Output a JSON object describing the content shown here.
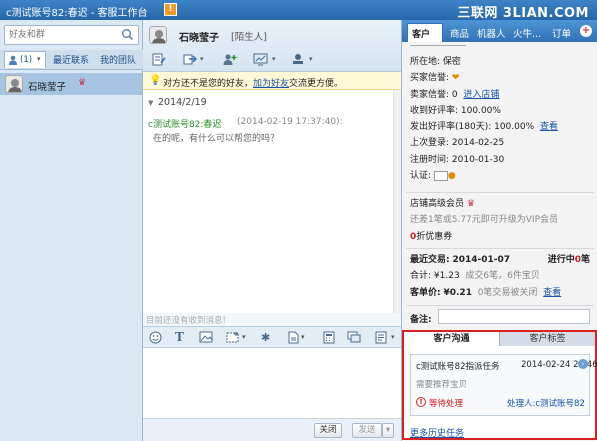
{
  "window": {
    "title": "c测试账号82:春迟 - 客服工作台",
    "watermark": "三联网 3LIAN.COM"
  },
  "left": {
    "search_placeholder": "好友和群",
    "tabs": {
      "contacts_count": "(1)",
      "recent": "最近联系",
      "team": "我的团队"
    },
    "contact": {
      "name": "石晓莹子"
    }
  },
  "chat": {
    "header": {
      "name": "石晓莹子",
      "tag": "[陌生人]"
    },
    "notice": {
      "before": "对方还不是您的好友，",
      "link": "加为好友",
      "after": "交流更方便。"
    },
    "date": "2014/2/19",
    "message": {
      "sender": "c测试账号82:春迟",
      "time": "(2014-02-19 17:37:40):",
      "text": "在的呢，有什么可以帮您的吗？"
    },
    "footer_hint": "目前还没有收到消息!",
    "buttons": {
      "close": "关闭",
      "send": "发送"
    }
  },
  "right": {
    "tabs": [
      "客户",
      "商品",
      "机器人",
      "火牛...",
      "订单"
    ],
    "info": {
      "location_label": "所在地:",
      "location": "保密",
      "buyer_credit_label": "买家信誉:",
      "seller_credit_label": "卖家信誉:",
      "seller_credit_value": "0",
      "shop_link": "进入店铺",
      "good_rate_label": "收到好评率:",
      "good_rate": "100.00%",
      "give_rate_label": "发出好评率(180天):",
      "give_rate": "100.00%",
      "view": "查看",
      "last_login_label": "上次登录:",
      "last_login": "2014-02-25",
      "register_label": "注册时间:",
      "register": "2010-01-30",
      "verify_label": "认证:"
    },
    "vip": {
      "title": "店铺高级会员",
      "desc": "还差1笔或5.77元即可升级为VIP会员",
      "discount_value": "0",
      "discount_text": "折优惠券"
    },
    "trade": {
      "recent_label": "最近交易:",
      "recent_date": "2014-01-07",
      "ongoing_label": "进行中",
      "ongoing_count": "0",
      "ongoing_unit": "笔",
      "total_label": "合计:",
      "total_amount": "¥1.23",
      "success": "成交6笔，6件宝贝",
      "avg_label": "客单价:",
      "avg_amount": "¥0.21",
      "closed": "0笔交易被关闭",
      "view": "查看"
    },
    "note_label": "备注:",
    "comm": {
      "tab_comm": "客户沟通",
      "tab_tags": "客户标签",
      "task_title": "c测试账号82指派任务",
      "task_time": "2014-02-24 22:46",
      "task_desc": "需要推荐宝贝",
      "status": "等待处理",
      "handler_label": "处理人:",
      "handler": "c测试账号82",
      "more": "更多历史任务"
    }
  },
  "colors": {
    "titlebar": "#2f72b6",
    "highlight_border": "#d52222",
    "link": "#1653a8"
  }
}
